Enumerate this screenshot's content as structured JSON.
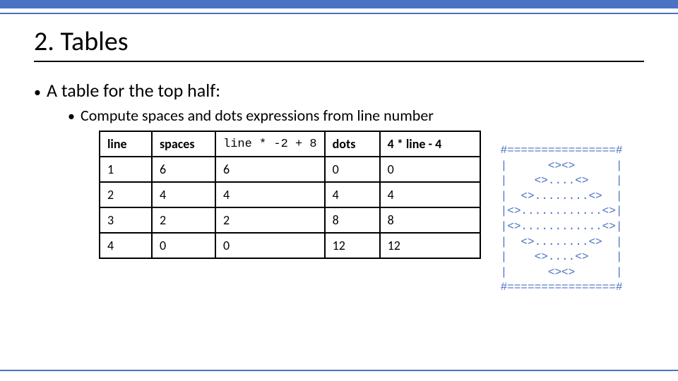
{
  "title": "2. Tables",
  "bullets": {
    "lvl1": "A table for the top half:",
    "lvl2": "Compute spaces and dots expressions from line number"
  },
  "chart_data": {
    "type": "table",
    "headers": {
      "line": "line",
      "spaces": "spaces",
      "expr_spaces": "line * -2 + 8",
      "dots": "dots",
      "expr_dots": "4 * line - 4"
    },
    "rows": [
      {
        "line": "1",
        "spaces": "6",
        "expr_spaces": "6",
        "dots": "0",
        "expr_dots": "0"
      },
      {
        "line": "2",
        "spaces": "4",
        "expr_spaces": "4",
        "dots": "4",
        "expr_dots": "4"
      },
      {
        "line": "3",
        "spaces": "2",
        "expr_spaces": "2",
        "dots": "8",
        "expr_dots": "8"
      },
      {
        "line": "4",
        "spaces": "0",
        "expr_spaces": "0",
        "dots": "12",
        "expr_dots": "12"
      }
    ]
  },
  "ascii_figure": "#================#\n|      <><>      |\n|    <>....<>    |\n|  <>........<>  |\n|<>............<>|\n|<>............<>|\n|  <>........<>  |\n|    <>....<>    |\n|      <><>      |\n#================#"
}
